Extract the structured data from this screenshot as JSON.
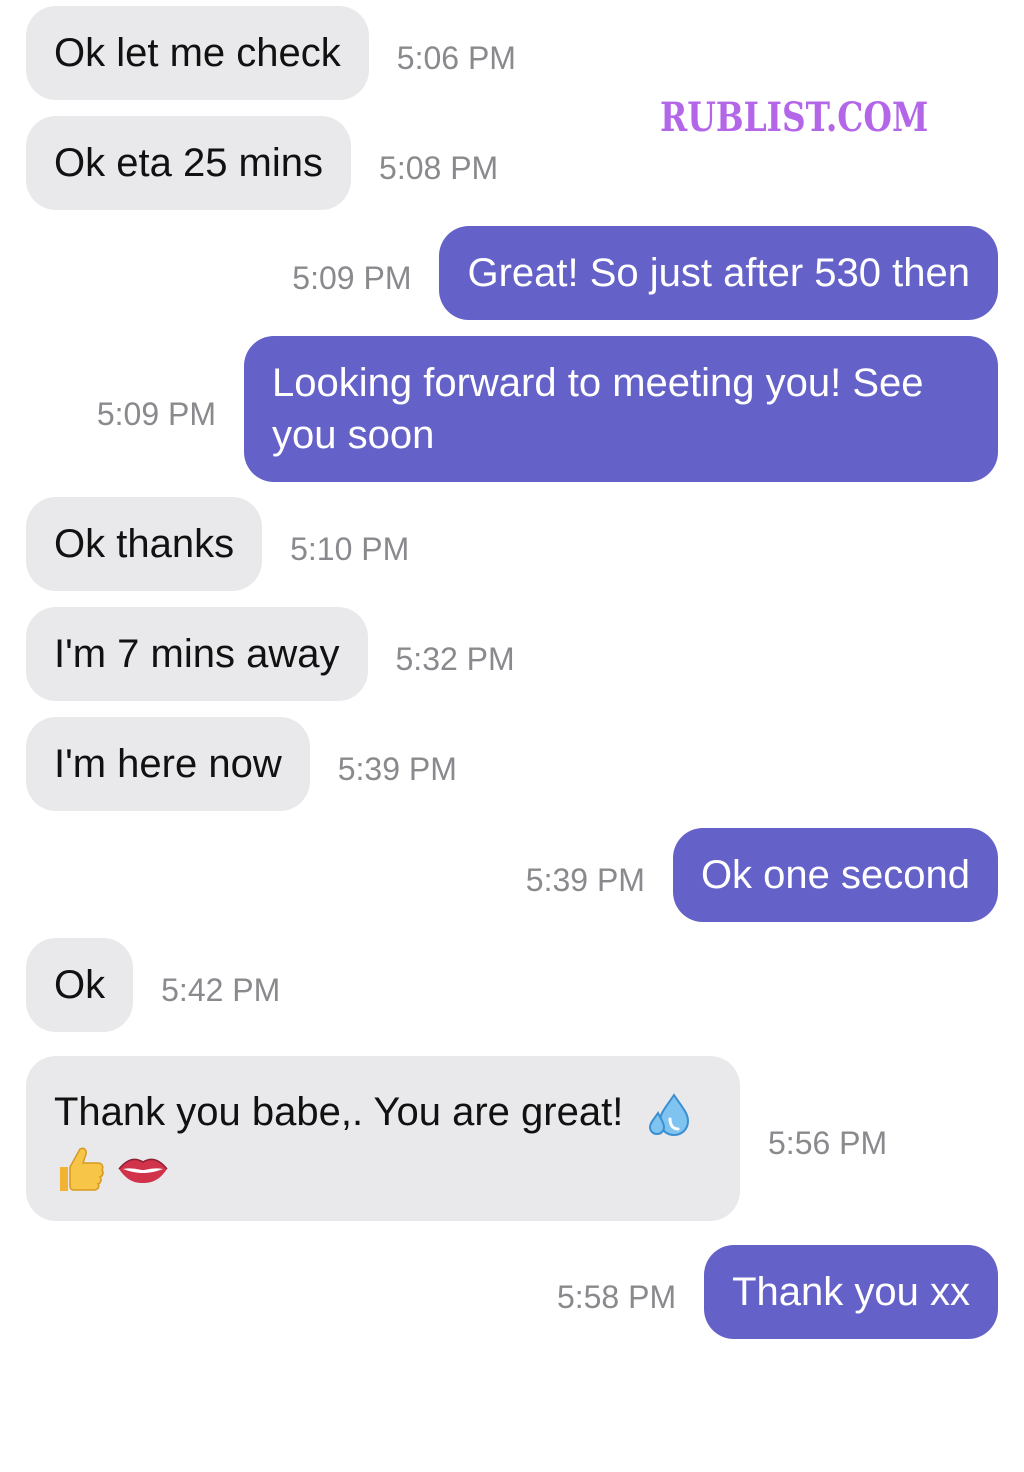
{
  "watermark": {
    "text": "RUBLIST.COM",
    "color": "#b466e8"
  },
  "colors": {
    "incoming_bubble": "#e9e9eb",
    "outgoing_bubble": "#6461c8",
    "timestamp": "#8a8a8e"
  },
  "messages": [
    {
      "direction": "incoming",
      "text": "Ok let me check",
      "time": "5:06 PM"
    },
    {
      "direction": "incoming",
      "text": "Ok eta 25 mins",
      "time": "5:08 PM"
    },
    {
      "direction": "outgoing",
      "text": "Great! So just after 530 then",
      "time": "5:09 PM"
    },
    {
      "direction": "outgoing",
      "text": "Looking forward to meeting you! See you soon",
      "time": "5:09 PM"
    },
    {
      "direction": "incoming",
      "text": "Ok thanks",
      "time": "5:10 PM"
    },
    {
      "direction": "incoming",
      "text": "I'm 7 mins away",
      "time": "5:32 PM"
    },
    {
      "direction": "incoming",
      "text": "I'm here now",
      "time": "5:39 PM"
    },
    {
      "direction": "outgoing",
      "text": "Ok one second",
      "time": "5:39 PM"
    },
    {
      "direction": "incoming",
      "text": "Ok",
      "time": "5:42 PM"
    },
    {
      "direction": "incoming",
      "text": "Thank you babe,.  You are great!",
      "emojis": [
        "sweat-droplets-icon",
        "thumbs-up-icon",
        "lips-icon"
      ],
      "time": "5:56 PM"
    },
    {
      "direction": "outgoing",
      "text": "Thank you xx",
      "time": "5:58 PM"
    }
  ]
}
